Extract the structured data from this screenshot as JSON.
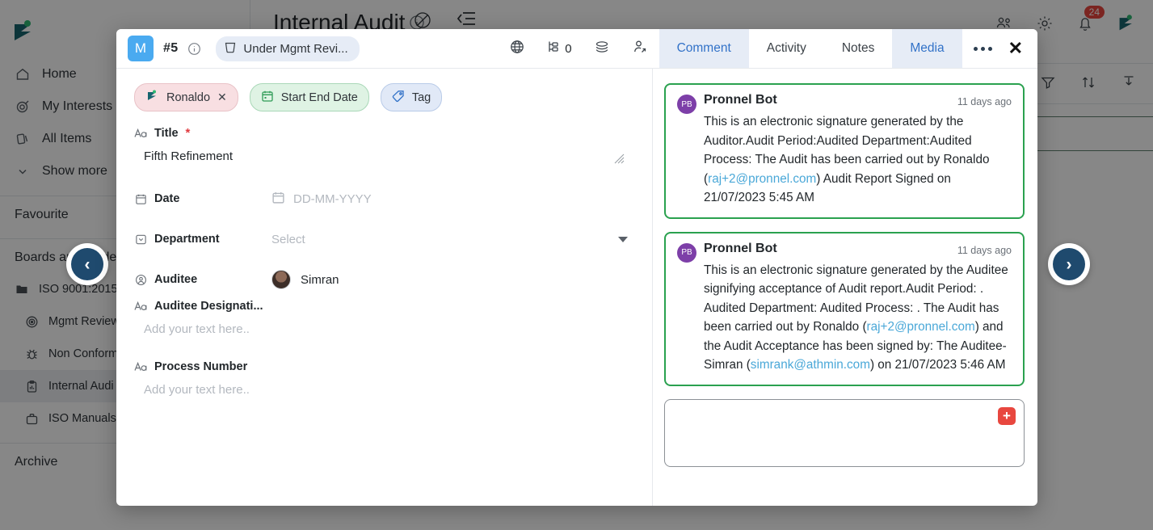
{
  "background": {
    "page_title": "Internal Audit",
    "sidebar": {
      "items": [
        {
          "label": "Home",
          "icon": "home-icon"
        },
        {
          "label": "My Interests",
          "icon": "target-icon"
        },
        {
          "label": "All Items",
          "icon": "cards-icon"
        },
        {
          "label": "Show more",
          "icon": "chevron-down-icon"
        }
      ],
      "sections": [
        {
          "label": "Favourite"
        },
        {
          "label": "Boards and Folders"
        },
        {
          "label": "Archive"
        }
      ],
      "board_group": "ISO 9001:2015",
      "boards": [
        {
          "label": "Mgmt Review",
          "icon": "target-ring-icon",
          "active": false
        },
        {
          "label": "Non Conform",
          "icon": "bug-icon",
          "active": false
        },
        {
          "label": "Internal Audi",
          "icon": "clipboard-chart-icon",
          "active": true
        },
        {
          "label": "ISO Manuals",
          "icon": "briefcase-icon",
          "active": false
        }
      ]
    },
    "topbar": {
      "notification_count": "24",
      "icons": [
        "people-icon",
        "gear-icon",
        "bell-icon",
        "app-logo-icon"
      ]
    },
    "toolbar_icons": [
      "filter-icon",
      "sort-icon",
      "download-icon"
    ],
    "left_icons": [
      "no-entry-icon",
      "collapse-icon"
    ]
  },
  "nav": {
    "prev_label": "‹",
    "next_label": "›"
  },
  "modal": {
    "header": {
      "avatar_letter": "M",
      "item_number": "#5",
      "status_label": "Under Mgmt Revi...",
      "status_icon": "bucket-icon",
      "subitem_count": "0",
      "icons": [
        "globe-icon",
        "hierarchy-icon",
        "layers-icon",
        "share-user-icon"
      ],
      "tabs": [
        {
          "label": "Comment",
          "active": true
        },
        {
          "label": "Activity",
          "active": false
        },
        {
          "label": "Notes",
          "active": false
        },
        {
          "label": "Media",
          "active": true
        }
      ],
      "more_label": "more-options",
      "close_label": "✕"
    },
    "chips": [
      {
        "label": "Ronaldo",
        "type": "person",
        "icon": "user-avatar-icon",
        "remove": "✕"
      },
      {
        "label": "Start End Date",
        "type": "date",
        "icon": "calendar-icon"
      },
      {
        "label": "Tag",
        "type": "tag",
        "icon": "tag-icon"
      }
    ],
    "fields": {
      "title": {
        "label": "Title",
        "required": "*",
        "icon": "text-format-icon",
        "value": "Fifth Refinement"
      },
      "date": {
        "label": "Date",
        "icon": "calendar-small-icon",
        "placeholder": "DD-MM-YYYY"
      },
      "department": {
        "label": "Department",
        "icon": "dropdown-box-icon",
        "placeholder": "Select"
      },
      "auditee": {
        "label": "Auditee",
        "icon": "user-circle-icon",
        "value": "Simran"
      },
      "auditee_designation": {
        "label": "Auditee Designati...",
        "icon": "text-format-icon",
        "placeholder": "Add your text here.."
      },
      "process_number": {
        "label": "Process Number",
        "icon": "text-format-icon",
        "placeholder": "Add your text here.."
      }
    },
    "comments": [
      {
        "avatar": "PB",
        "author": "Pronnel Bot",
        "time": "11 days ago",
        "body_parts": [
          {
            "t": "This is an electronic signature generated by the Auditor.Audit Period:Audited Department:Audited Process: The Audit has been carried out by Ronaldo ("
          },
          {
            "t": "raj+2@pronnel.com",
            "link": true
          },
          {
            "t": ") Audit Report Signed on 21/07/2023 5:45 AM"
          }
        ]
      },
      {
        "avatar": "PB",
        "author": "Pronnel Bot",
        "time": "11 days ago",
        "body_parts": [
          {
            "t": "This is an electronic signature generated by the Auditee signifying acceptance of Audit report.Audit Period: . Audited Department: Audited Process: . The Audit has been carried out by Ronaldo ("
          },
          {
            "t": "raj+2@pronnel.com",
            "link": true
          },
          {
            "t": ") and the Audit Acceptance has been signed by: The Auditee-Simran ("
          },
          {
            "t": "simrank@athmin.com",
            "link": true
          },
          {
            "t": ") on 21/07/2023 5:46 AM"
          }
        ]
      }
    ],
    "comment_input": {
      "placeholder": "",
      "add_label": "+"
    }
  },
  "colors": {
    "accent_blue": "#3272c8",
    "comment_border_green": "#2aa14f",
    "add_red": "#e8473f",
    "bot_avatar_purple": "#7d3fa8",
    "avatar_blue": "#4aaaf0",
    "link_blue": "#4aa8d8"
  }
}
